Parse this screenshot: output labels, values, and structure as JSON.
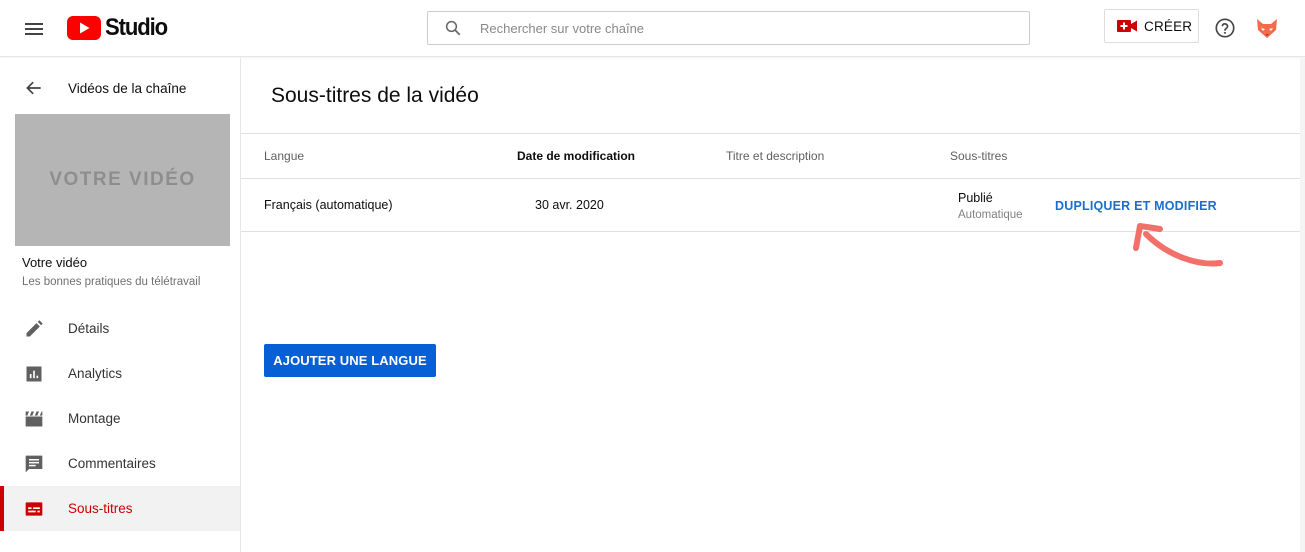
{
  "header": {
    "logo_text": "Studio",
    "search_placeholder": "Rechercher sur votre chaîne",
    "create_label": "CRÉER",
    "brand_red": "#ff0000"
  },
  "sidebar": {
    "back_label": "Vidéos de la chaîne",
    "thumbnail_text": "VOTRE VIDÉO",
    "video_title": "Votre vidéo",
    "video_subtitle": "Les bonnes pratiques du télétravail",
    "items": [
      {
        "label": "Détails",
        "icon": "pencil-icon",
        "active": false
      },
      {
        "label": "Analytics",
        "icon": "analytics-icon",
        "active": false
      },
      {
        "label": "Montage",
        "icon": "clapperboard-icon",
        "active": false
      },
      {
        "label": "Commentaires",
        "icon": "comment-icon",
        "active": false
      },
      {
        "label": "Sous-titres",
        "icon": "subtitles-icon",
        "active": true
      }
    ]
  },
  "main": {
    "page_title": "Sous-titres de la vidéo",
    "table": {
      "headers": [
        "Langue",
        "Date de modification",
        "Titre et description",
        "Sous-titres"
      ],
      "rows": [
        {
          "language": "Français (automatique)",
          "modified": "30 avr. 2020",
          "title_description": "",
          "status": "Publié",
          "status_sub": "Automatique",
          "action": "DUPLIQUER ET MODIFIER"
        }
      ]
    },
    "add_language_label": "AJOUTER UNE LANGUE"
  },
  "colors": {
    "accent_blue": "#065fd4",
    "link_blue": "#1a6ed1",
    "active_red": "#cc0000",
    "annotation_arrow": "#f2706a"
  }
}
